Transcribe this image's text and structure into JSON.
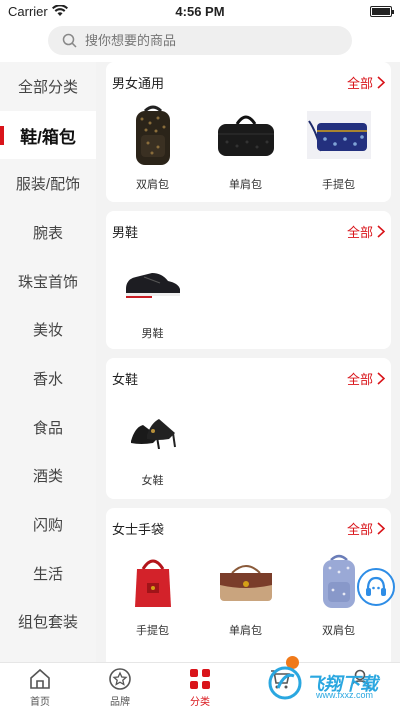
{
  "status_bar": {
    "carrier": "Carrier",
    "time": "4:56 PM"
  },
  "search": {
    "placeholder": "搜你想要的商品"
  },
  "sidebar": {
    "items": [
      {
        "label": "全部分类"
      },
      {
        "label": "鞋/箱包",
        "active": true
      },
      {
        "label": "服装/配饰"
      },
      {
        "label": "腕表"
      },
      {
        "label": "珠宝首饰"
      },
      {
        "label": "美妆"
      },
      {
        "label": "香水"
      },
      {
        "label": "食品"
      },
      {
        "label": "酒类"
      },
      {
        "label": "闪购"
      },
      {
        "label": "生活"
      },
      {
        "label": "组包套装"
      }
    ]
  },
  "sections": [
    {
      "title": "男女通用",
      "more": "全部",
      "items": [
        {
          "label": "双肩包",
          "icon": "backpack-icon"
        },
        {
          "label": "单肩包",
          "icon": "duffel-bag-icon"
        },
        {
          "label": "手提包",
          "icon": "clutch-icon"
        }
      ]
    },
    {
      "title": "男鞋",
      "more": "全部",
      "items": [
        {
          "label": "男鞋",
          "icon": "sneaker-icon"
        }
      ]
    },
    {
      "title": "女鞋",
      "more": "全部",
      "items": [
        {
          "label": "女鞋",
          "icon": "heels-icon"
        }
      ]
    },
    {
      "title": "女士手袋",
      "more": "全部",
      "items": [
        {
          "label": "手提包",
          "icon": "bucket-bag-icon"
        },
        {
          "label": "单肩包",
          "icon": "shoulder-bag-icon"
        },
        {
          "label": "双肩包",
          "icon": "backpack-icon"
        }
      ]
    }
  ],
  "tabbar": {
    "items": [
      {
        "label": "首页",
        "icon": "home-icon"
      },
      {
        "label": "品牌",
        "icon": "star-icon"
      },
      {
        "label": "分类",
        "icon": "category-icon",
        "active": true
      },
      {
        "label": "",
        "icon": "cart-icon"
      },
      {
        "label": "",
        "icon": "user-icon"
      }
    ]
  },
  "watermark": {
    "text": "飞翔下载",
    "url": "www.fxxz.com"
  },
  "colors": {
    "accent": "#d9141a",
    "sidebar_bg": "#f5f5f5",
    "content_bg": "#f3f3f3"
  }
}
